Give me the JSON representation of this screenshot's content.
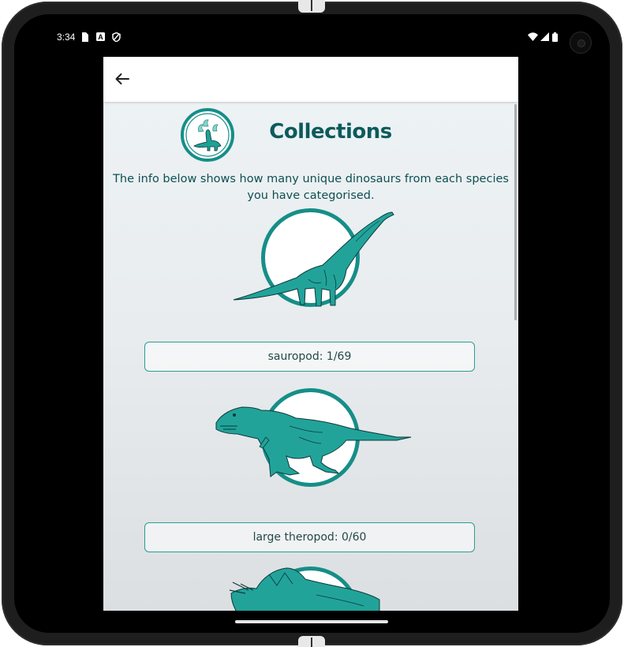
{
  "status_bar": {
    "time": "3:34",
    "icons": [
      "sim-card-icon",
      "a-notification-icon",
      "shield-icon",
      "wifi-icon",
      "signal-icon",
      "battery-icon"
    ]
  },
  "app_bar": {
    "back_icon": "arrow-left-icon"
  },
  "header": {
    "title": "Collections",
    "logo_icon": "dinosaur-logo-icon",
    "subtitle": "The info below shows how many unique dinosaurs from each species you have categorised."
  },
  "collections": [
    {
      "label": "sauropod: 1/69",
      "species": "sauropod",
      "found": 1,
      "total": 69,
      "icon": "sauropod-icon"
    },
    {
      "label": "large theropod: 0/60",
      "species": "large theropod",
      "found": 0,
      "total": 60,
      "icon": "theropod-icon"
    },
    {
      "label": "",
      "species": "ceratopsian",
      "icon": "ceratopsian-icon"
    }
  ],
  "colors": {
    "accent": "#168e88",
    "title": "#0c5a5c",
    "dino_fill": "#22a39a",
    "dino_stroke": "#0b3a3b"
  }
}
